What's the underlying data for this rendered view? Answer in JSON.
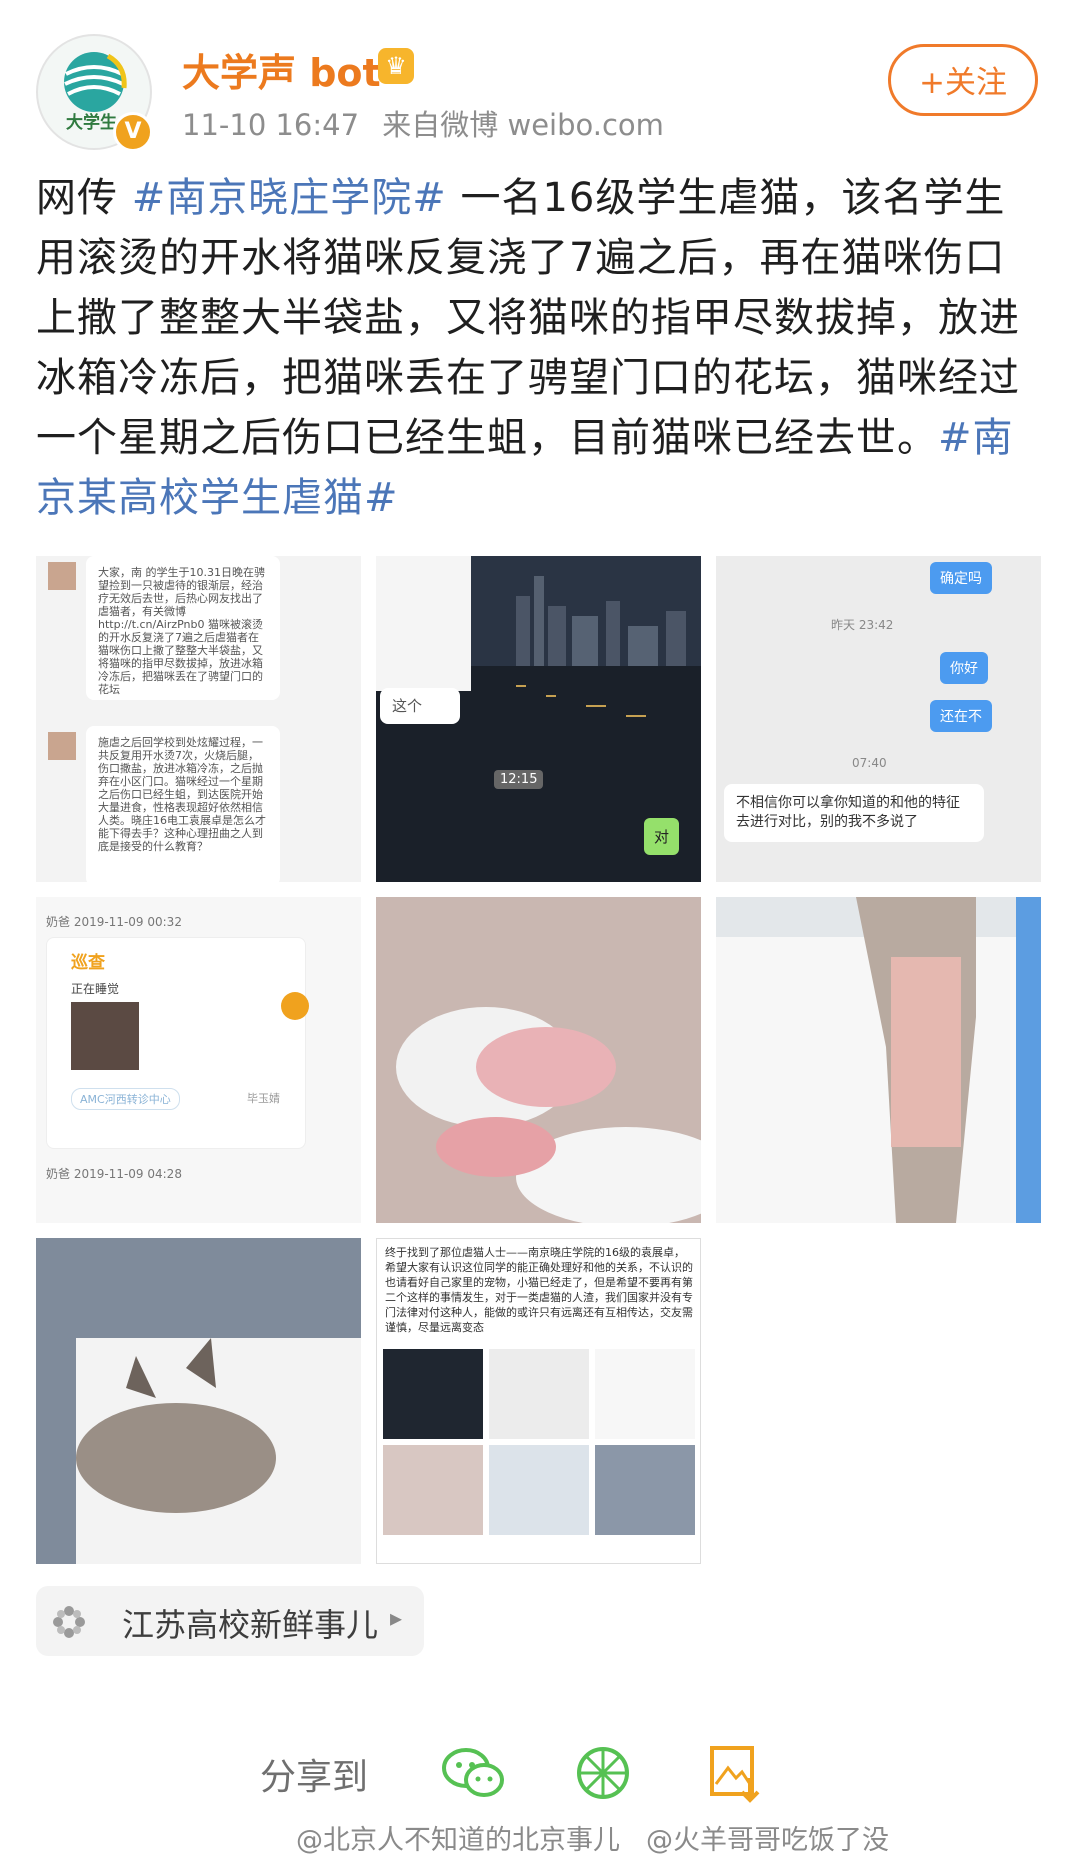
{
  "account": {
    "avatar_label": "大学生",
    "verified_badge": "V",
    "username": "大学声 bot",
    "crown_icon": "crown-icon",
    "time": "11-10 16:47",
    "source": "来自微博 weibo.com",
    "follow_label": "+关注"
  },
  "post": {
    "text_before": "网传 ",
    "topic1": "#南京晓庄学院#",
    "text_mid": " 一名16级学生虐猫，该名学生用滚烫的开水将猫咪反复浇了7遍之后，再在猫咪伤口上撒了整整大半袋盐，又将猫咪的指甲尽数拔掉，放进冰箱冷冻后，把猫咪丢在了骋望门口的花坛，猫咪经过一个星期之后伤口已经生蛆，目前猫咪已经去世。",
    "topic2": "#南京某高校学生虐猫#"
  },
  "images": {
    "tile1_text1": "大家，南 的学生于10.31日晚在骋望捡到一只被虐待的银渐层，经治疗无效后去世，后热心网友找出了虐猫者，有关微博 http://t.cn/AirzPnb0 猫咪被滚烫的开水反复浇了7遍之后虐猫者在猫咪伤口上撒了整整大半袋盐，又将猫咪的指甲尽数拔掉，放进冰箱冷冻后，把猫咪丢在了骋望门口的花坛",
    "tile1_text2": "施虐之后回学校到处炫耀过程，一共反复用开水烫7次，火烧后腿，伤口撒盐，放进冰箱冷冻，之后抛弃在小区门口。猫咪经过一个星期之后伤口已经生蛆，到达医院开始大量进食，性格表现超好依然相信人类。晓庄16电工袁展卓是怎么才能下得去手？这种心理扭曲之人到底是接受的什么教育？",
    "tile2_bubble1": "这个",
    "tile2_time": "12:15",
    "tile2_bubble2": "对",
    "tile3_bubble1": "确定吗",
    "tile3_time1": "昨天 23:42",
    "tile3_bubble2": "你好",
    "tile3_bubble3": "还在不",
    "tile3_time2": "07:40",
    "tile3_bubble4": "不相信你可以拿你知道的和他的特征去进行对比，别的我不多说了",
    "tile4_user": "奶爸 2019-11-09 00:32",
    "tile4_title": "巡查",
    "tile4_sub": "正在睡觉",
    "tile4_link": "AMC河西转诊中心",
    "tile4_right": "毕玉婧",
    "tile4_user2": "奶爸 2019-11-09 04:28",
    "tile8_text": "终于找到了那位虐猫人士——南京晓庄学院的16级的袁展卓，希望大家有认识这位同学的能正确处理好和他的关系，不认识的也请看好自己家里的宠物，小猫已经走了，但是希望不要再有第二个这样的事情发生，对于一类虐猫的人渣，我们国家并没有专门法律对付这种人，能做的或许只有远离还有互相传达，交友需谨慎，尽量远离变态"
  },
  "tag": {
    "icon": "topic-flower-icon",
    "label": "江苏高校新鲜事儿",
    "arrow": "▸"
  },
  "share": {
    "label": "分享到",
    "icons": [
      "wechat-icon",
      "moments-icon",
      "save-image-icon"
    ]
  },
  "watermarks": {
    "left": "@北京人不知道的北京事儿",
    "right": "@火羊哥哥吃饭了没"
  },
  "colors": {
    "username": "#ec7a1e",
    "topic": "#4b76b8",
    "follow": "#f07a2a",
    "wechat": "#56c153"
  }
}
